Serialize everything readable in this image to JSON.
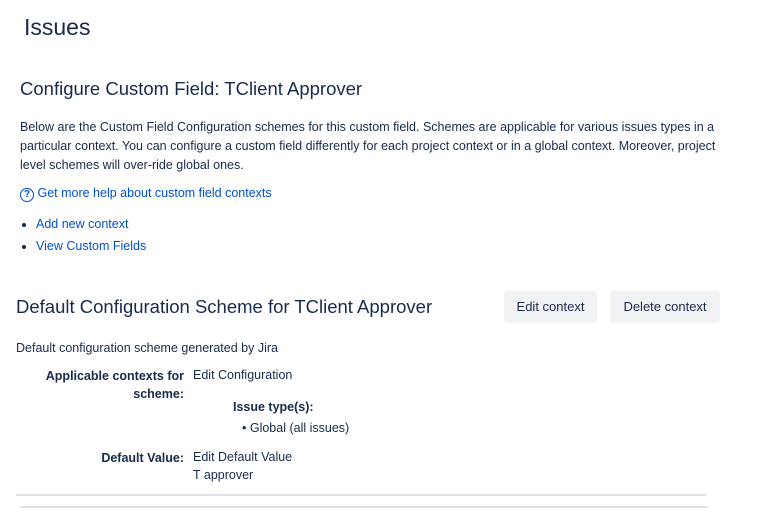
{
  "page_title": "Issues",
  "config_title": "Configure Custom Field: TClient Approver",
  "description": "Below are the Custom Field Configuration schemes for this custom field. Schemes are applicable for various issues types in a particular context. You can configure a custom field differently for each project context or in a global context. Moreover, project level schemes will over-ride global ones.",
  "help_link": "Get more help about custom field contexts",
  "links": [
    "Add new context",
    "View Custom Fields"
  ],
  "scheme": {
    "title": "Default Configuration Scheme for TClient Approver",
    "edit_context": "Edit context",
    "delete_context": "Delete context",
    "description": "Default configuration scheme generated by Jira",
    "contexts_label": "Applicable contexts for scheme:",
    "edit_configuration": "Edit Configuration",
    "issue_types_label": "Issue type(s):",
    "issue_types": [
      "Global (all issues)"
    ],
    "default_value_label": "Default Value:",
    "edit_default_value": "Edit Default Value",
    "default_value": "T approver"
  }
}
